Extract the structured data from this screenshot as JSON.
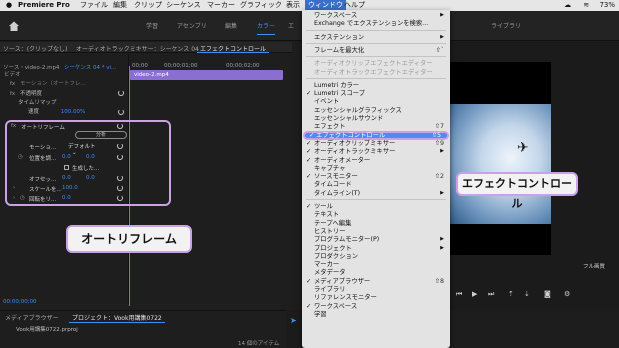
{
  "menubar": {
    "apple": "",
    "app": "Premiere Pro",
    "items": [
      "ファイル",
      "編集",
      "クリップ",
      "シーケンス",
      "マーカー",
      "グラフィック",
      "表示",
      "ウィンドウ",
      "ヘルプ"
    ],
    "battery": "73%"
  },
  "workspace_tabs": [
    "学習",
    "アセンブリ",
    "編集",
    "カラー",
    "エ"
  ],
  "workspace_tabs_right": [
    "ライブラリ"
  ],
  "effect_controls": {
    "tabs": [
      "ソース：(クリップなし)",
      "オーディオトラックミキサー：シーケンス 04",
      "エフェクトコントロール"
    ],
    "source": "ソース・video-2.mp4",
    "sequence": "シーケンス 04 * vi...",
    "time1": "00;00",
    "time2": "00;00;01;00",
    "time3": "00;00;02;00",
    "clip": "video-2.mp4",
    "section": "ビデオ",
    "rows": [
      {
        "label": "モーション（オートフレ…",
        "fx": "fx"
      },
      {
        "label": "不透明度",
        "fx": "fx"
      },
      {
        "label": "タイムリマップ",
        "fx": ""
      },
      {
        "label": "速度",
        "value": "100.00%"
      }
    ],
    "timecode": "00;00;00;00"
  },
  "auto_reframe": {
    "title": "オートリフレーム",
    "analyze": "分析",
    "motion_label": "モーショ...",
    "motion_value": "デフォルト",
    "position_label": "位置を調...",
    "position_value1": "0.0",
    "position_value2": "0.0",
    "generated_label": "生成した...",
    "offset_label": "オフセッ...",
    "offset_value1": "0.0",
    "offset_value2": "0.0",
    "scale_label": "スケールを...",
    "scale_value": "100.0",
    "rotate_label": "回転をリ...",
    "rotate_value": "0.0"
  },
  "callouts": {
    "auto_reframe": "オートリフレーム",
    "effect_controls": "エフェクトコントロール"
  },
  "program": {
    "fit": "フル画質"
  },
  "bottom": {
    "tabs": [
      "メディアブラウザー",
      "プロジェクト：Vook用講集0722"
    ],
    "project_file": "Vook用講集0722.prproj",
    "item_count": "14 個のアイテム"
  },
  "menu": {
    "items": [
      {
        "label": "ワークスペース",
        "type": "submenu"
      },
      {
        "label": "Exchange でエクステンションを検索...",
        "type": "item"
      },
      {
        "type": "sep"
      },
      {
        "label": "エクステンション",
        "type": "submenu"
      },
      {
        "type": "sep"
      },
      {
        "label": "フレームを最大化",
        "type": "item",
        "shortcut": "⇧`"
      },
      {
        "type": "sep"
      },
      {
        "label": "オーディオクリップエフェクトエディター",
        "type": "disabled"
      },
      {
        "label": "オーディオトラックエフェクトエディター",
        "type": "disabled"
      },
      {
        "type": "sep"
      },
      {
        "label": "Lumetri カラー",
        "type": "item"
      },
      {
        "label": "Lumetri スコープ",
        "type": "check"
      },
      {
        "label": "イベント",
        "type": "item"
      },
      {
        "label": "エッセンシャルグラフィックス",
        "type": "item"
      },
      {
        "label": "エッセンシャルサウンド",
        "type": "item"
      },
      {
        "label": "エフェクト",
        "type": "item",
        "shortcut": "⇧7"
      },
      {
        "label": "エフェクトコントロール",
        "type": "highlight",
        "shortcut": "⇧5"
      },
      {
        "label": "オーディオクリップミキサー",
        "type": "check",
        "shortcut": "⇧9"
      },
      {
        "label": "オーディオトラックミキサー",
        "type": "check_submenu"
      },
      {
        "label": "オーディオメーター",
        "type": "check"
      },
      {
        "label": "キャプチャ",
        "type": "item"
      },
      {
        "label": "ソースモニター",
        "type": "check_submenu",
        "shortcut": "⇧2"
      },
      {
        "label": "タイムコード",
        "type": "item"
      },
      {
        "label": "タイムライン(T)",
        "type": "submenu"
      },
      {
        "type": "sep"
      },
      {
        "label": "ツール",
        "type": "check"
      },
      {
        "label": "テキスト",
        "type": "item"
      },
      {
        "label": "テープへ編集",
        "type": "item"
      },
      {
        "label": "ヒストリー",
        "type": "item"
      },
      {
        "label": "プログラムモニター(P)",
        "type": "submenu"
      },
      {
        "label": "プロジェクト",
        "type": "submenu"
      },
      {
        "label": "プロダクション",
        "type": "item"
      },
      {
        "label": "マーカー",
        "type": "item"
      },
      {
        "label": "メタデータ",
        "type": "item"
      },
      {
        "label": "メディアブラウザー",
        "type": "check",
        "shortcut": "⇧8"
      },
      {
        "label": "ライブラリ",
        "type": "item"
      },
      {
        "label": "リファレンスモニター",
        "type": "item"
      },
      {
        "label": "ワークスペース",
        "type": "check"
      },
      {
        "label": "学習",
        "type": "item"
      }
    ]
  },
  "colors": {
    "accent": "#3d8ef6",
    "highlight_border": "#c9a1e6",
    "menu_highlight": "#4d8df0",
    "clip": "#8a6fd0"
  }
}
